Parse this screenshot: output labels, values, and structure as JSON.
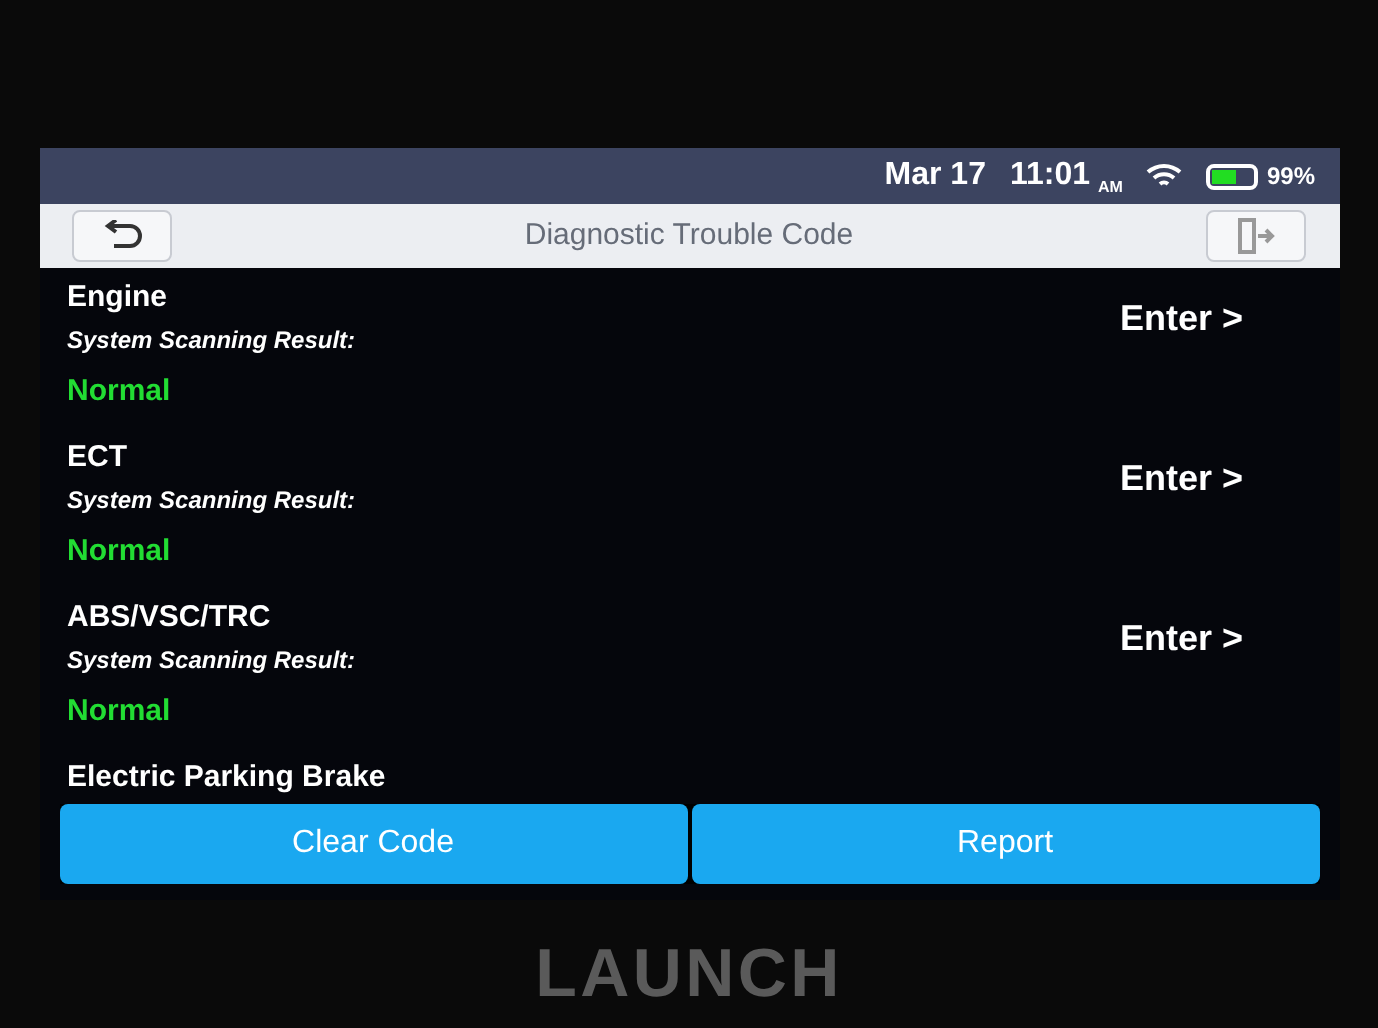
{
  "status_bar": {
    "date": "Mar 17",
    "time": "11:01",
    "ampm": "AM",
    "battery": "99%"
  },
  "header": {
    "title": "Diagnostic Trouble Code"
  },
  "systems": [
    {
      "name": "Engine",
      "label": "System Scanning Result:",
      "result": "Normal",
      "action": "Enter >"
    },
    {
      "name": "ECT",
      "label": "System Scanning Result:",
      "result": "Normal",
      "action": "Enter >"
    },
    {
      "name": "ABS/VSC/TRC",
      "label": "System Scanning Result:",
      "result": "Normal",
      "action": "Enter >"
    },
    {
      "name": "Electric Parking Brake"
    }
  ],
  "buttons": [
    "Clear Code",
    "Report"
  ],
  "bezel": {
    "brand": "LAUNCH"
  }
}
